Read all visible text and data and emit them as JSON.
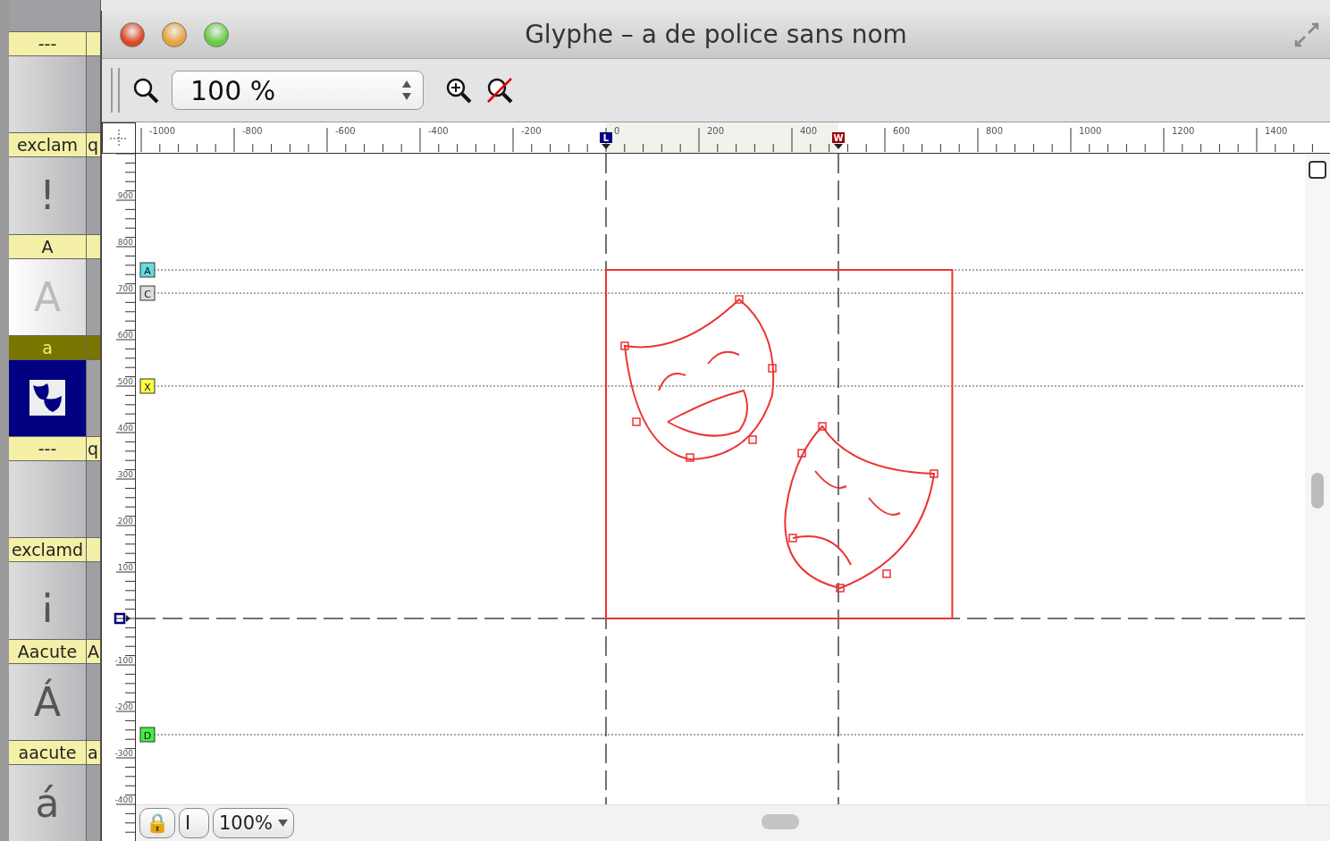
{
  "glyph_list": [
    {
      "name": "---",
      "kind": "empty",
      "selected": false
    },
    {
      "name": "exclam",
      "name_2": "q",
      "glyph": "!",
      "kind": "char",
      "selected": false
    },
    {
      "name": "A",
      "glyph": "A",
      "kind": "faint",
      "selected": false
    },
    {
      "name": "a",
      "kind": "masks",
      "selected": true
    },
    {
      "name": "---",
      "name_2": "q",
      "kind": "empty",
      "selected": false
    },
    {
      "name": "exclamd",
      "glyph": "¡",
      "kind": "char",
      "selected": false
    },
    {
      "name": "Aacute",
      "name_2": "A",
      "glyph": "Á",
      "kind": "char",
      "selected": false
    },
    {
      "name": "aacute",
      "name_2": "a",
      "glyph": "á",
      "kind": "char",
      "selected": false
    }
  ],
  "window": {
    "title": "Glyphe – a de police sans nom"
  },
  "toolbar": {
    "zoom": "100 %"
  },
  "ruler": {
    "x_labels": [
      "-1000",
      "-800",
      "-600",
      "-400",
      "-200",
      "0",
      "200",
      "400",
      "600",
      "800",
      "1000",
      "1200",
      "1400"
    ],
    "y_labels": [
      "900",
      "800",
      "700",
      "600",
      "500",
      "400",
      "300",
      "200",
      "100",
      "-100",
      "-200",
      "-300",
      "-400"
    ],
    "markers": [
      {
        "label": "L",
        "color": "#000080"
      },
      {
        "label": "W",
        "color": "#990000"
      }
    ]
  },
  "guides": [
    {
      "label": "A",
      "color": "#66dddd"
    },
    {
      "label": "C",
      "color": "#dddddd"
    },
    {
      "label": "X",
      "color": "#ffff44"
    },
    {
      "label": "D",
      "color": "#44ee44"
    }
  ],
  "status_bar": {
    "lock": "🔒",
    "cursor": "I",
    "zoom": "100%"
  }
}
